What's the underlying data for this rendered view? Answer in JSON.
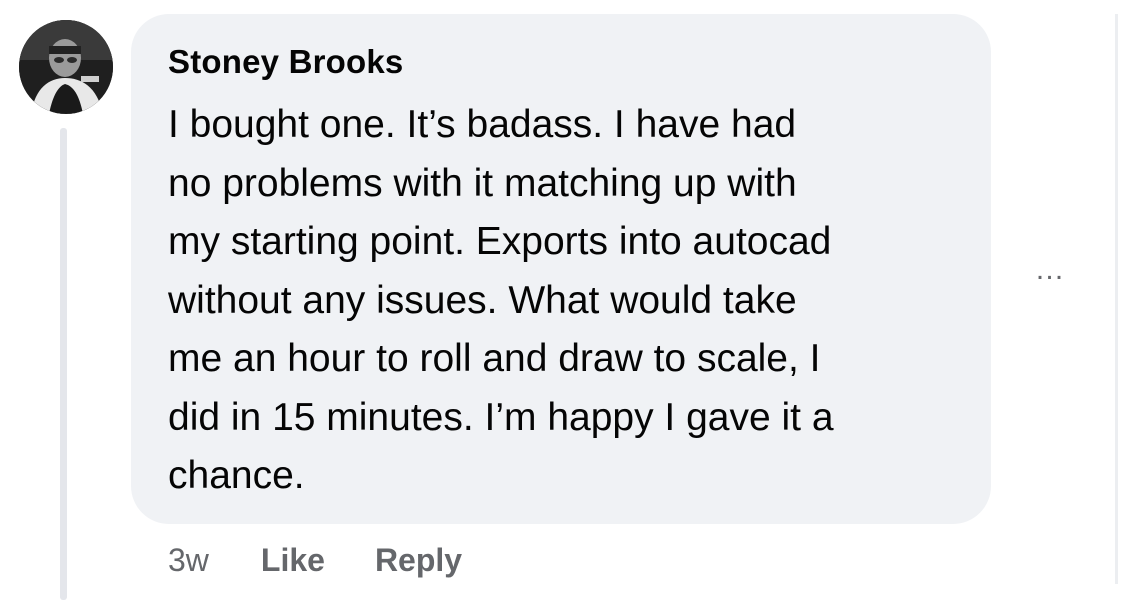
{
  "comment": {
    "author": "Stoney Brooks",
    "lines": [
      "I bought one. It’s badass. I have had",
      "no problems with it matching up with",
      "my starting point. Exports into autocad",
      "without any issues. What would take",
      "me an hour to roll and draw to scale, I",
      "did in 15 minutes. I’m happy I gave it a",
      "chance."
    ],
    "more_icon": "…"
  },
  "actions": {
    "timestamp": "3w",
    "like_label": "Like",
    "reply_label": "Reply"
  },
  "colors": {
    "bubble_bg": "#f0f2f5",
    "text": "#050505",
    "secondary_text": "#65676b",
    "thread_line": "#e4e6eb"
  },
  "icons": {
    "avatar": "user-avatar-photo",
    "more": "more-options-icon"
  }
}
